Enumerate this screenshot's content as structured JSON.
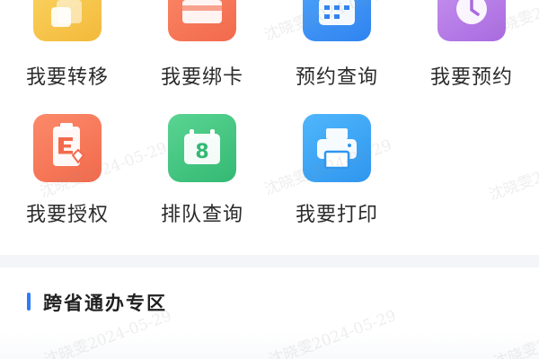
{
  "grid": {
    "items": [
      {
        "label": "我要转移",
        "icon": "transfer-icon",
        "color": "#f7c548"
      },
      {
        "label": "我要绑卡",
        "icon": "card-icon",
        "color": "#f7795a"
      },
      {
        "label": "预约查询",
        "icon": "calendar-icon",
        "color": "#3c93f5"
      },
      {
        "label": "我要预约",
        "icon": "clock-icon",
        "color": "#b97de8"
      },
      {
        "label": "我要授权",
        "icon": "authorize-icon",
        "color": "#f7795a"
      },
      {
        "label": "排队查询",
        "icon": "queue-number-icon",
        "color": "#3fc782"
      },
      {
        "label": "我要打印",
        "icon": "printer-icon",
        "color": "#3c93f5"
      }
    ]
  },
  "section": {
    "title": "跨省通办专区",
    "accent_color": "#2d7cf6"
  },
  "watermark": {
    "text": "沈晓雯2024-05-29"
  },
  "queue_icon_digit": "8"
}
